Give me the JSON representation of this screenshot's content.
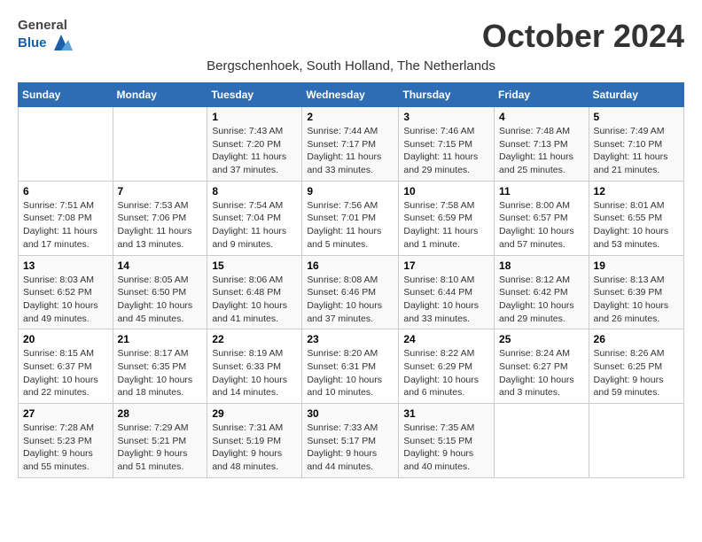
{
  "header": {
    "logo_general": "General",
    "logo_blue": "Blue",
    "month_title": "October 2024",
    "subtitle": "Bergschenhoek, South Holland, The Netherlands"
  },
  "weekdays": [
    "Sunday",
    "Monday",
    "Tuesday",
    "Wednesday",
    "Thursday",
    "Friday",
    "Saturday"
  ],
  "weeks": [
    [
      {
        "day": "",
        "info": ""
      },
      {
        "day": "",
        "info": ""
      },
      {
        "day": "1",
        "info": "Sunrise: 7:43 AM\nSunset: 7:20 PM\nDaylight: 11 hours and 37 minutes."
      },
      {
        "day": "2",
        "info": "Sunrise: 7:44 AM\nSunset: 7:17 PM\nDaylight: 11 hours and 33 minutes."
      },
      {
        "day": "3",
        "info": "Sunrise: 7:46 AM\nSunset: 7:15 PM\nDaylight: 11 hours and 29 minutes."
      },
      {
        "day": "4",
        "info": "Sunrise: 7:48 AM\nSunset: 7:13 PM\nDaylight: 11 hours and 25 minutes."
      },
      {
        "day": "5",
        "info": "Sunrise: 7:49 AM\nSunset: 7:10 PM\nDaylight: 11 hours and 21 minutes."
      }
    ],
    [
      {
        "day": "6",
        "info": "Sunrise: 7:51 AM\nSunset: 7:08 PM\nDaylight: 11 hours and 17 minutes."
      },
      {
        "day": "7",
        "info": "Sunrise: 7:53 AM\nSunset: 7:06 PM\nDaylight: 11 hours and 13 minutes."
      },
      {
        "day": "8",
        "info": "Sunrise: 7:54 AM\nSunset: 7:04 PM\nDaylight: 11 hours and 9 minutes."
      },
      {
        "day": "9",
        "info": "Sunrise: 7:56 AM\nSunset: 7:01 PM\nDaylight: 11 hours and 5 minutes."
      },
      {
        "day": "10",
        "info": "Sunrise: 7:58 AM\nSunset: 6:59 PM\nDaylight: 11 hours and 1 minute."
      },
      {
        "day": "11",
        "info": "Sunrise: 8:00 AM\nSunset: 6:57 PM\nDaylight: 10 hours and 57 minutes."
      },
      {
        "day": "12",
        "info": "Sunrise: 8:01 AM\nSunset: 6:55 PM\nDaylight: 10 hours and 53 minutes."
      }
    ],
    [
      {
        "day": "13",
        "info": "Sunrise: 8:03 AM\nSunset: 6:52 PM\nDaylight: 10 hours and 49 minutes."
      },
      {
        "day": "14",
        "info": "Sunrise: 8:05 AM\nSunset: 6:50 PM\nDaylight: 10 hours and 45 minutes."
      },
      {
        "day": "15",
        "info": "Sunrise: 8:06 AM\nSunset: 6:48 PM\nDaylight: 10 hours and 41 minutes."
      },
      {
        "day": "16",
        "info": "Sunrise: 8:08 AM\nSunset: 6:46 PM\nDaylight: 10 hours and 37 minutes."
      },
      {
        "day": "17",
        "info": "Sunrise: 8:10 AM\nSunset: 6:44 PM\nDaylight: 10 hours and 33 minutes."
      },
      {
        "day": "18",
        "info": "Sunrise: 8:12 AM\nSunset: 6:42 PM\nDaylight: 10 hours and 29 minutes."
      },
      {
        "day": "19",
        "info": "Sunrise: 8:13 AM\nSunset: 6:39 PM\nDaylight: 10 hours and 26 minutes."
      }
    ],
    [
      {
        "day": "20",
        "info": "Sunrise: 8:15 AM\nSunset: 6:37 PM\nDaylight: 10 hours and 22 minutes."
      },
      {
        "day": "21",
        "info": "Sunrise: 8:17 AM\nSunset: 6:35 PM\nDaylight: 10 hours and 18 minutes."
      },
      {
        "day": "22",
        "info": "Sunrise: 8:19 AM\nSunset: 6:33 PM\nDaylight: 10 hours and 14 minutes."
      },
      {
        "day": "23",
        "info": "Sunrise: 8:20 AM\nSunset: 6:31 PM\nDaylight: 10 hours and 10 minutes."
      },
      {
        "day": "24",
        "info": "Sunrise: 8:22 AM\nSunset: 6:29 PM\nDaylight: 10 hours and 6 minutes."
      },
      {
        "day": "25",
        "info": "Sunrise: 8:24 AM\nSunset: 6:27 PM\nDaylight: 10 hours and 3 minutes."
      },
      {
        "day": "26",
        "info": "Sunrise: 8:26 AM\nSunset: 6:25 PM\nDaylight: 9 hours and 59 minutes."
      }
    ],
    [
      {
        "day": "27",
        "info": "Sunrise: 7:28 AM\nSunset: 5:23 PM\nDaylight: 9 hours and 55 minutes."
      },
      {
        "day": "28",
        "info": "Sunrise: 7:29 AM\nSunset: 5:21 PM\nDaylight: 9 hours and 51 minutes."
      },
      {
        "day": "29",
        "info": "Sunrise: 7:31 AM\nSunset: 5:19 PM\nDaylight: 9 hours and 48 minutes."
      },
      {
        "day": "30",
        "info": "Sunrise: 7:33 AM\nSunset: 5:17 PM\nDaylight: 9 hours and 44 minutes."
      },
      {
        "day": "31",
        "info": "Sunrise: 7:35 AM\nSunset: 5:15 PM\nDaylight: 9 hours and 40 minutes."
      },
      {
        "day": "",
        "info": ""
      },
      {
        "day": "",
        "info": ""
      }
    ]
  ]
}
